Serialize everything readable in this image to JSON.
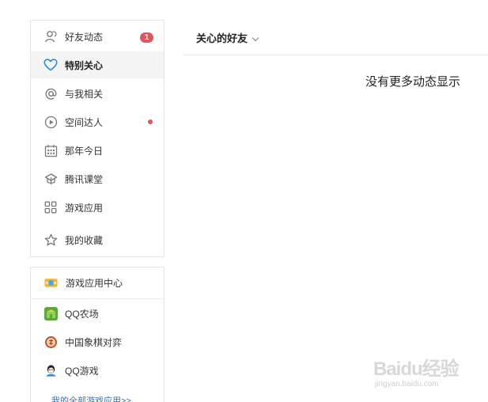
{
  "sidebar": {
    "items": [
      {
        "label": "好友动态",
        "icon": "person-icon",
        "badge": "1"
      },
      {
        "label": "特别关心",
        "icon": "heart-icon",
        "active": true
      },
      {
        "label": "与我相关",
        "icon": "at-icon"
      },
      {
        "label": "空间达人",
        "icon": "play-circle-icon",
        "dot": true
      },
      {
        "label": "那年今日",
        "icon": "calendar-icon"
      },
      {
        "label": "腾讯课堂",
        "icon": "graduation-cap-icon"
      },
      {
        "label": "游戏应用",
        "icon": "apps-grid-icon"
      },
      {
        "label": "我的收藏",
        "icon": "star-icon"
      }
    ]
  },
  "games": {
    "header": "游戏应用中心",
    "items": [
      {
        "label": "QQ农场",
        "icon": "farm-icon"
      },
      {
        "label": "中国象棋对弈",
        "icon": "chess-icon"
      },
      {
        "label": "QQ游戏",
        "icon": "qq-game-icon"
      }
    ],
    "all_link": "我的全部游戏应用>>"
  },
  "main": {
    "filter_title": "关心的好友",
    "empty_message": "没有更多动态显示"
  },
  "watermark": {
    "brand": "Baidu经验",
    "url": "jingyan.baidu.com"
  },
  "colors": {
    "accent_blue": "#2b8be8",
    "badge_red": "#e0555b",
    "link_blue": "#3a6fb0",
    "active_bg": "#f4f4f4"
  }
}
